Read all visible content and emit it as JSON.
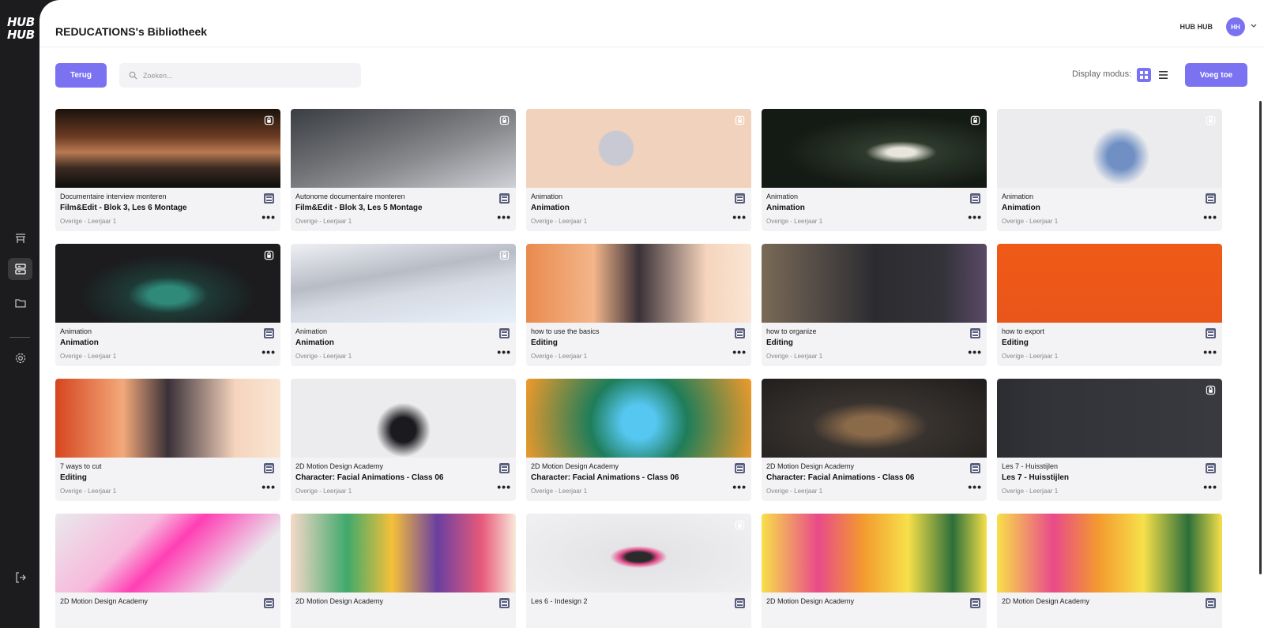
{
  "brand": {
    "logo_line1": "HUB",
    "logo_line2": "HUB"
  },
  "header": {
    "title": "REDUCATIONS's Bibliotheek",
    "user_name": "HUB HUB",
    "avatar_initials": "HH"
  },
  "toolbar": {
    "back_label": "Terug",
    "search_placeholder": "Zoeken...",
    "display_mode_label": "Display modus:",
    "add_label": "Voeg toe",
    "active_mode": "grid"
  },
  "colors": {
    "accent": "#7b72f2",
    "sidebar": "#1c1c1e",
    "card_bg": "#f3f3f6"
  },
  "sidebar": {
    "items": [
      "board-icon",
      "library-icon",
      "folder-icon",
      "settings-icon",
      "logout-icon"
    ]
  },
  "cards": [
    {
      "subtitle": "Documentaire interview monteren",
      "title": "Film&Edit - Blok 3, Les 6 Montage",
      "meta": "Overige - Leerjaar 1",
      "locked": true,
      "thumb": "linear-gradient(180deg,#1a120c 0%,#6b3a22 35%,#b87a52 55%,#3b2a22 75%,#0d0d0d 100%)"
    },
    {
      "subtitle": "Autonome documentaire monteren",
      "title": "Film&Edit - Blok 3, Les 5 Montage",
      "meta": "Overige - Leerjaar 1",
      "locked": true,
      "thumb": "linear-gradient(160deg,#3a3d42 0%,#6d6f73 40%,#8a8b8f 60%,#cfd1d6 100%)"
    },
    {
      "subtitle": "Animation",
      "title": "Animation",
      "meta": "Overige - Leerjaar 1",
      "locked": true,
      "thumb": "radial-gradient(circle at 40% 50%,#c9c9d3 0 12%,#f1d3bd 13% 100%)"
    },
    {
      "subtitle": "Animation",
      "title": "Animation",
      "meta": "Overige - Leerjaar 1",
      "locked": true,
      "thumb": "radial-gradient(ellipse at 62% 55%,#e8e6dc 0 7%,#2d3a2c 18%,#141a14 60%)"
    },
    {
      "subtitle": "Animation",
      "title": "Animation",
      "meta": "Overige - Leerjaar 1",
      "locked": true,
      "thumb": "radial-gradient(circle at 55% 60%,#7090c4 0 10%,#ececee 22%),linear-gradient(90deg,#ececee,#f4c7dd)"
    },
    {
      "subtitle": "Animation",
      "title": "Animation",
      "meta": "Overige - Leerjaar 1",
      "locked": true,
      "thumb": "radial-gradient(ellipse at 50% 65%,#2f8a7a 0 12%,#1e3a36 25%,#1c1c1e 55%)"
    },
    {
      "subtitle": "Animation",
      "title": "Animation",
      "meta": "Overige - Leerjaar 1",
      "locked": true,
      "thumb": "linear-gradient(170deg,#eef0f4 0%,#b8bcc6 40%,#d6dae2 60%,#e6f0fb 100%)"
    },
    {
      "subtitle": "how to use the basics",
      "title": "Editing",
      "meta": "Overige - Leerjaar 1",
      "locked": false,
      "thumb": "linear-gradient(90deg,#e98a4e 0%,#f3b68a 30%,#3a3138 50%,#f6d4bd 80%,#f9e6d4 100%)"
    },
    {
      "subtitle": "how to organize",
      "title": "Editing",
      "meta": "Overige - Leerjaar 1",
      "locked": false,
      "thumb": "linear-gradient(90deg,#7a6a56 0%,#4b4542 30%,#2c2c30 50%,#323238 80%,#5a4a66 100%)"
    },
    {
      "subtitle": "how to export",
      "title": "Editing",
      "meta": "Overige - Leerjaar 1",
      "locked": false,
      "thumb": "linear-gradient(180deg,#f05a18 0%,#e9561a 100%)"
    },
    {
      "subtitle": "7 ways to cut",
      "title": "Editing",
      "meta": "Overige - Leerjaar 1",
      "locked": false,
      "thumb": "linear-gradient(90deg,#d6451f 0%,#f3a97a 30%,#3a3138 50%,#f6d4bd 80%,#f9e6d4 100%)"
    },
    {
      "subtitle": "2D Motion Design Academy",
      "title": "Character: Facial Animations - Class 06",
      "meta": "Overige - Leerjaar 1",
      "locked": false,
      "thumb": "radial-gradient(circle at 50% 65%,#1b1b1f 0 10%,#ececee 22%),linear-gradient(90deg,#ececee,#f1d4e4)"
    },
    {
      "subtitle": "2D Motion Design Academy",
      "title": "Character: Facial Animations - Class 06",
      "meta": "Overige - Leerjaar 1",
      "locked": false,
      "thumb": "radial-gradient(circle at 50% 55%,#56c7f1 0 14%,#1e7d5a 40%,#f29a2a 100%)"
    },
    {
      "subtitle": "2D Motion Design Academy",
      "title": "Character: Facial Animations - Class 06",
      "meta": "Overige - Leerjaar 1",
      "locked": false,
      "thumb": "radial-gradient(ellipse at 48% 60%,#8b6a4a 0 14%,#38332f 35%,#1f1d1c 100%)"
    },
    {
      "subtitle": "Les 7 - Huisstijlen",
      "title": "Les 7 - Huisstijlen",
      "meta": "Overige - Leerjaar 1",
      "locked": true,
      "thumb": "linear-gradient(90deg,#2b2d31 0%,#313338 20%,#383a40 100%)"
    },
    {
      "subtitle": "2D Motion Design Academy",
      "title": "",
      "meta": "",
      "locked": false,
      "thumb": "linear-gradient(135deg,#e9e9ec 0%,#f7b8dc 35%,#ff3fb4 50%,#e9e9ec 80%)"
    },
    {
      "subtitle": "2D Motion Design Academy",
      "title": "",
      "meta": "",
      "locked": false,
      "thumb": "linear-gradient(90deg,#f6d9c9 0%,#3fa96b 25%,#f5c03a 45%,#6a3fa0 65%,#e85a7a 85%,#f8e9da 100%)"
    },
    {
      "subtitle": "Les 6 - Indesign 2",
      "title": "",
      "meta": "",
      "locked": true,
      "thumb": "radial-gradient(ellipse at 50% 55%,#2b2b2b 0 8%,#e44a8c 12%,#e4e4e6 18%,#f1f1f3 100%)"
    },
    {
      "subtitle": "2D Motion Design Academy",
      "title": "",
      "meta": "",
      "locked": false,
      "thumb": "linear-gradient(90deg,#f7e04a 0%,#e94a8a 25%,#f39a2f 45%,#f7e04a 65%,#2c6f3a 85%,#f7e04a 100%)"
    },
    {
      "subtitle": "2D Motion Design Academy",
      "title": "",
      "meta": "",
      "locked": false,
      "thumb": "linear-gradient(90deg,#f7e04a 0%,#e94a8a 25%,#f39a2f 45%,#f7e04a 65%,#2c6f3a 85%,#f7e04a 100%)"
    }
  ]
}
